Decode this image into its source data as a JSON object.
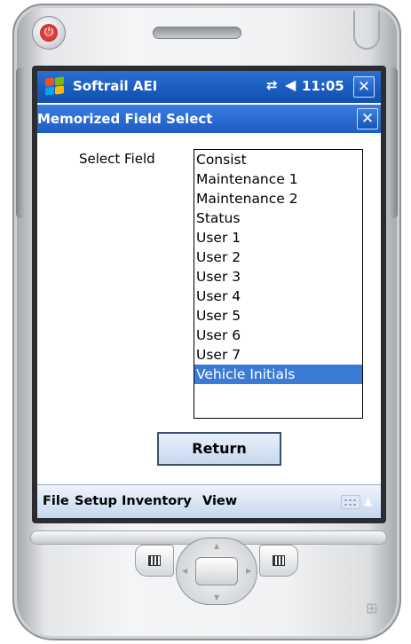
{
  "title_bar": {
    "app_title": "Softrail AEI",
    "clock": "11:05",
    "close_label": "✕",
    "start_icon": "windows-flag-icon",
    "sync_icon": "sync-icon",
    "volume_icon": "volume-icon"
  },
  "dialog": {
    "title": "Memorized Field Select",
    "close_label": "✕"
  },
  "form": {
    "field_label": "Select Field",
    "list_items": [
      "Consist",
      "Maintenance 1",
      "Maintenance 2",
      "Status",
      "User 1",
      "User 2",
      "User 3",
      "User 4",
      "User 5",
      "User 6",
      "User 7",
      "Vehicle Initials"
    ],
    "selected_item": "Vehicle Initials",
    "return_label": "Return"
  },
  "menu_bar": {
    "items": [
      "File",
      "Setup",
      "Inventory",
      "View"
    ],
    "keyboard_icon": "keyboard-icon"
  },
  "colors": {
    "title_bar": "#0f4fb0",
    "selection": "#3a7bd5",
    "power_button": "#c01818"
  }
}
